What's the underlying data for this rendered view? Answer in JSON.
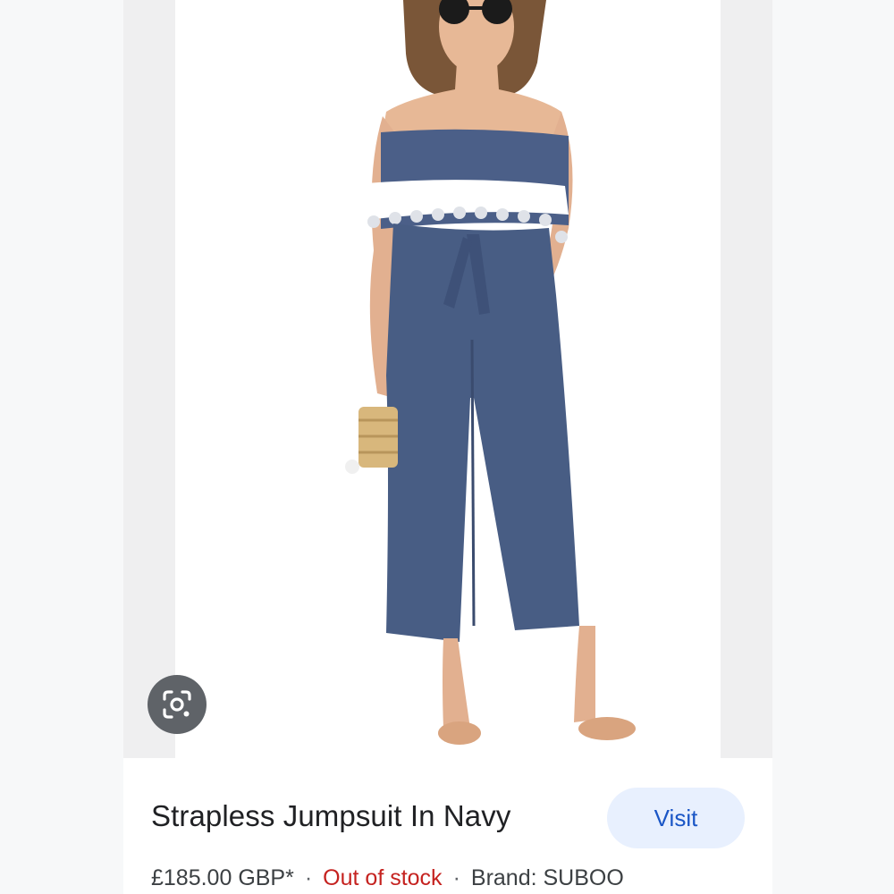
{
  "product": {
    "title": "Strapless Jumpsuit In Navy",
    "price": "£185.00 GBP*",
    "separator": "·",
    "stock_status": "Out of stock",
    "brand": "Brand: SUBOO"
  },
  "actions": {
    "visit_label": "Visit",
    "lens_icon": "google-lens-icon"
  },
  "colors": {
    "visit_text": "#1a56c6",
    "visit_bg": "#e8f0fe",
    "out_of_stock": "#c5221f",
    "garment_navy": "#485d84"
  }
}
